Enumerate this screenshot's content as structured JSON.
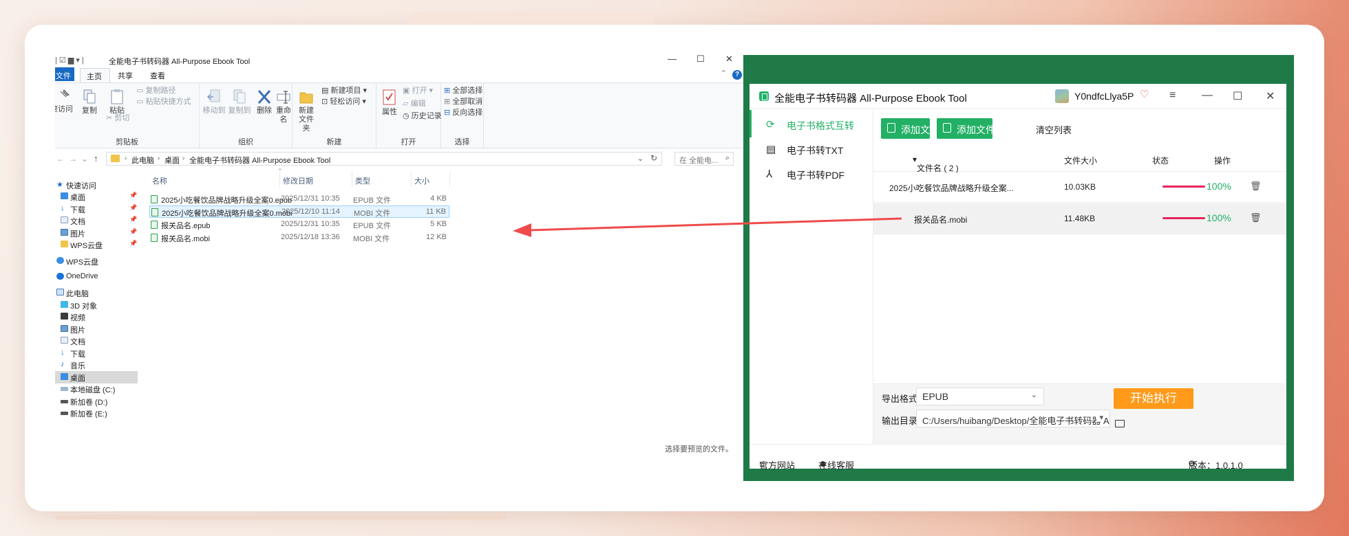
{
  "explorer": {
    "title": "全能电子书转码器 All-Purpose Ebook Tool",
    "tabs": {
      "file": "文件",
      "home": "主页",
      "share": "共享",
      "view": "查看"
    },
    "ribbon": {
      "clipboard": {
        "label": "剪贴板",
        "pin": "固定到快速访问",
        "copy": "复制",
        "paste": "粘贴",
        "copy_path": "复制路径",
        "paste_shortcut": "粘贴快捷方式",
        "cut": "剪切"
      },
      "organize": {
        "label": "组织",
        "move_to": "移动到",
        "copy_to": "复制到",
        "delete": "删除",
        "rename": "重命名"
      },
      "new": {
        "label": "新建",
        "new_folder": "新建文件夹",
        "new_item": "新建项目",
        "easy_access": "轻松访问"
      },
      "open": {
        "label": "打开",
        "properties": "属性",
        "open": "打开",
        "edit": "编辑",
        "history": "历史记录"
      },
      "select": {
        "label": "选择",
        "select_all": "全部选择",
        "select_none": "全部取消",
        "invert": "反向选择"
      }
    },
    "address": {
      "crumbs": [
        "此电脑",
        "桌面",
        "全能电子书转码器 All-Purpose Ebook Tool"
      ],
      "search_placeholder": "在 全能电..."
    },
    "nav": {
      "quick_access": "快速访问",
      "qa_items": [
        "桌面",
        "下载",
        "文档",
        "图片",
        "WPS云盘"
      ],
      "wps": "WPS云盘",
      "onedrive": "OneDrive",
      "this_pc": "此电脑",
      "pc_items": [
        "3D 对象",
        "视频",
        "图片",
        "文档",
        "下载",
        "音乐",
        "桌面",
        "本地磁盘 (C:)",
        "新加卷 (D:)",
        "新加卷 (E:)"
      ]
    },
    "columns": {
      "name": "名称",
      "date": "修改日期",
      "type": "类型",
      "size": "大小"
    },
    "files": [
      {
        "name": "2025小吃餐饮品牌战略升级全案0.epub",
        "date": "2025/12/31 10:35",
        "type": "EPUB 文件",
        "size": "4 KB"
      },
      {
        "name": "2025小吃餐饮品牌战略升级全案0.mobi",
        "date": "2025/12/10 11:14",
        "type": "MOBI 文件",
        "size": "11 KB"
      },
      {
        "name": "报关品名.epub",
        "date": "2025/12/31 10:35",
        "type": "EPUB 文件",
        "size": "5 KB"
      },
      {
        "name": "报关品名.mobi",
        "date": "2025/12/18 13:36",
        "type": "MOBI 文件",
        "size": "12 KB"
      }
    ],
    "preview_message": "选择要预览的文件。"
  },
  "app": {
    "title": "全能电子书转码器 All-Purpose Ebook Tool",
    "username": "Y0ndfcLlya5P",
    "sidebar": [
      "电子书格式互转",
      "电子书转TXT",
      "电子书转PDF"
    ],
    "toolbar": {
      "add_file": "添加文件",
      "add_folder": "添加文件夹",
      "clear": "清空列表"
    },
    "table": {
      "col_name": "文件名 ( 2 )",
      "col_size": "文件大小",
      "col_status": "状态",
      "col_action": "操作",
      "rows": [
        {
          "name": "2025小吃餐饮品牌战略升级全案...",
          "size": "10.03KB",
          "status": "100%",
          "progress": 1.0
        },
        {
          "name": "报关品名.mobi",
          "size": "11.48KB",
          "status": "100%",
          "progress": 1.0
        }
      ]
    },
    "export_format_label": "导出格式:",
    "export_format_value": "EPUB",
    "output_dir_label": "输出目录:",
    "output_dir_value": "C:/Users/huibang/Desktop/全能电子书转码器 All-Pu",
    "start_button": "开始执行",
    "footer": {
      "website": "官方网站",
      "support": "在线客服",
      "version": "版本：1.0.1.0"
    }
  },
  "colors": {
    "accent_green": "#23b065",
    "frame_green": "#1f7a47",
    "start_orange": "#ff9a1a",
    "progress_red": "#e8245a",
    "arrow_red": "#ef4b4b"
  }
}
